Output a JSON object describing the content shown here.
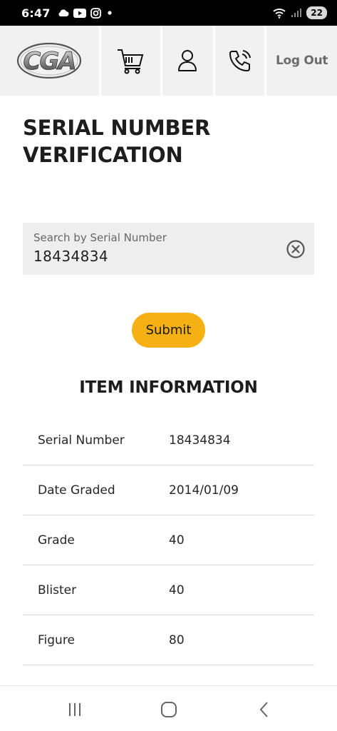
{
  "status_bar": {
    "time": "6:47",
    "battery": "22",
    "icons": [
      "cloud-icon",
      "youtube-icon",
      "instagram-icon",
      "dot-icon",
      "wifi-icon",
      "signal-icon"
    ]
  },
  "header": {
    "logo_text": "CGA",
    "logout_label": "Log Out",
    "icons": [
      "cart-icon",
      "user-icon",
      "phone-icon"
    ]
  },
  "page": {
    "title": "SERIAL NUMBER VERIFICATION"
  },
  "search": {
    "label": "Search by Serial Number",
    "value": "18434834"
  },
  "submit_label": "Submit",
  "item_info": {
    "title": "ITEM INFORMATION",
    "rows": [
      {
        "key": "Serial Number",
        "value": "18434834"
      },
      {
        "key": "Date Graded",
        "value": "2014/01/09"
      },
      {
        "key": "Grade",
        "value": "40"
      },
      {
        "key": "Blister",
        "value": "40"
      },
      {
        "key": "Figure",
        "value": "80"
      }
    ]
  },
  "colors": {
    "accent": "#f7b014",
    "header_bg": "#f1f1f1",
    "field_bg": "#eeeeee"
  },
  "nav": {
    "icons": [
      "recents-icon",
      "home-icon",
      "back-icon"
    ]
  }
}
